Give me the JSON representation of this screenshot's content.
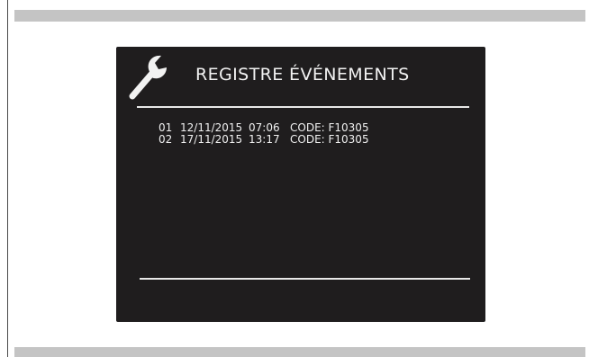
{
  "screen": {
    "title": "REGISTRE ÉVÉNEMENTS",
    "icon": "wrench-icon",
    "events": [
      {
        "index": "01",
        "date": "12/11/2015",
        "time": "07:06",
        "code": "CODE: F10305"
      },
      {
        "index": "02",
        "date": "17/11/2015",
        "time": "13:17",
        "code": "CODE: F10305"
      }
    ]
  },
  "colors": {
    "screen_background": "#1f1d1e",
    "screen_text": "#f2f2f2",
    "band": "#c4c4c4"
  }
}
